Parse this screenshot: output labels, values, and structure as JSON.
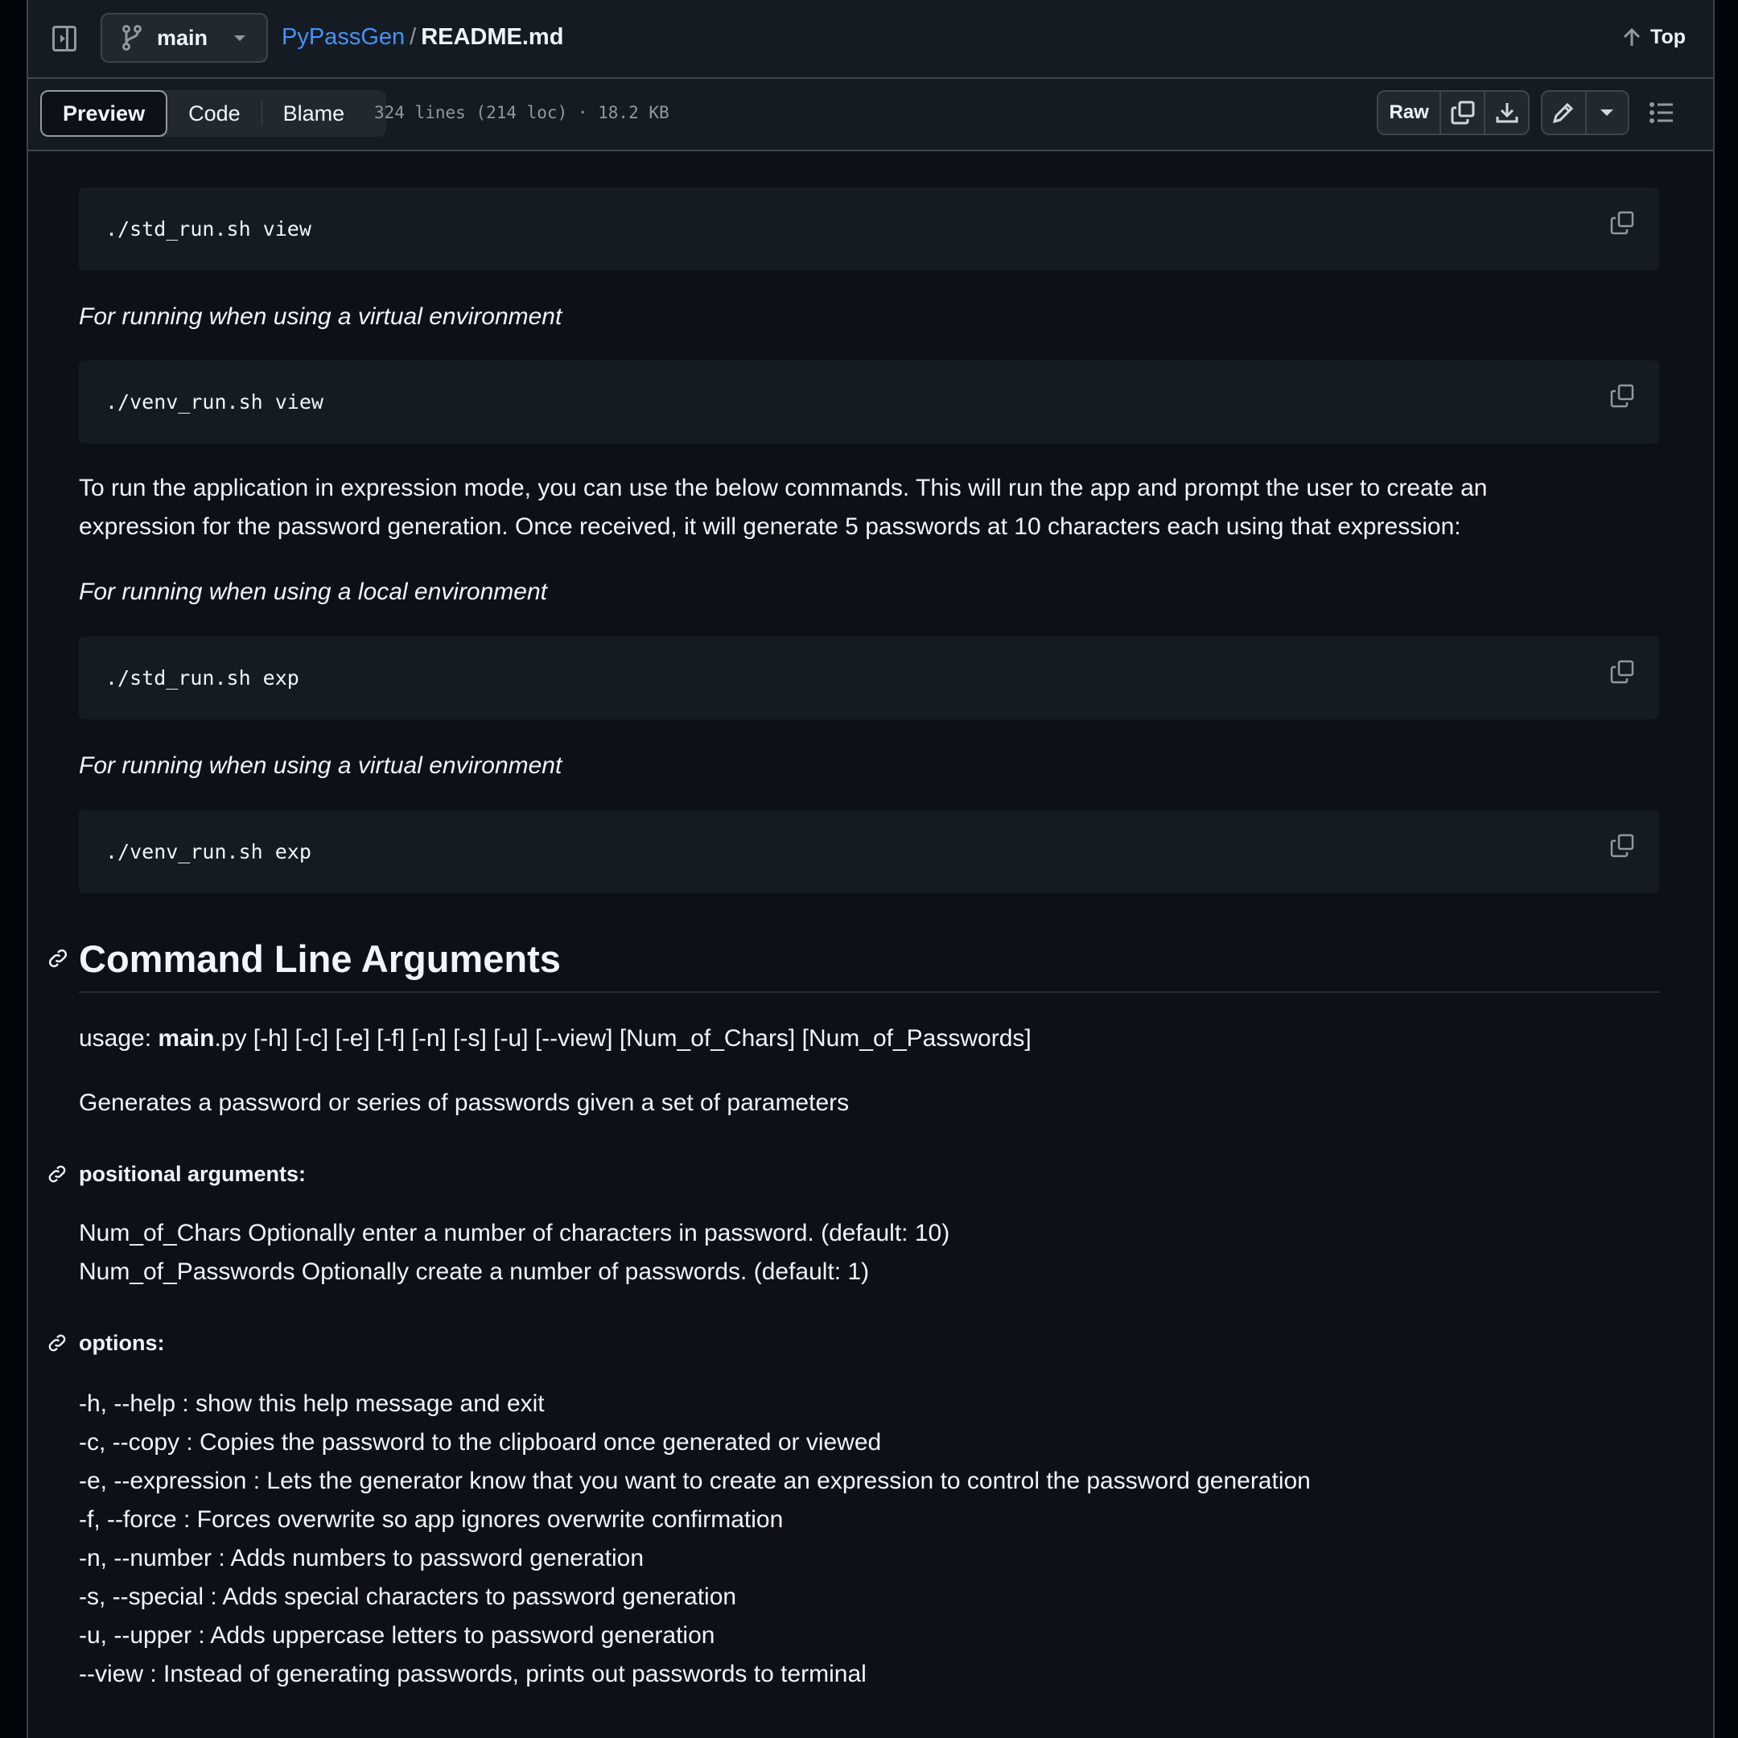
{
  "header": {
    "branch": "main",
    "repo": "PyPassGen",
    "separator": "/",
    "file": "README.md",
    "top_label": "Top"
  },
  "toolbar": {
    "tabs": [
      {
        "label": "Preview",
        "active": true
      },
      {
        "label": "Code"
      },
      {
        "label": "Blame"
      }
    ],
    "file_meta": "324 lines (214 loc) · 18.2 KB",
    "raw_label": "Raw"
  },
  "content": {
    "code1": "./std_run.sh view",
    "note1": "For running when using a virtual environment",
    "code2": "./venv_run.sh view",
    "para_line1": "To run the application in expression mode, you can use the below commands. This will run the app and prompt the user to create an",
    "para_line2": "expression for the password generation. Once received, it will generate 5 passwords at 10 characters each using that expression:",
    "note2": "For running when using a local environment",
    "code3": "./std_run.sh exp",
    "note3": "For running when using a virtual environment",
    "code4": "./venv_run.sh exp",
    "heading": "Command Line Arguments",
    "usage_prefix": "usage: ",
    "usage_bold": "main",
    "usage_rest": ".py [-h] [-c] [-e] [-f] [-n] [-s] [-u] [--view] [Num_of_Chars] [Num_of_Passwords]",
    "description": "Generates a password or series of passwords given a set of parameters",
    "positional_heading": "positional arguments:",
    "positional": [
      "Num_of_Chars Optionally enter a number of characters in password. (default: 10)",
      "Num_of_Passwords Optionally create a number of passwords. (default: 1)"
    ],
    "options_heading": "options:",
    "options": [
      "-h, --help : show this help message and exit",
      "-c, --copy : Copies the password to the clipboard once generated or viewed",
      "-e, --expression : Lets the generator know that you want to create an expression to control the password generation",
      "-f, --force : Forces overwrite so app ignores overwrite confirmation",
      "-n, --number : Adds numbers to password generation",
      "-s, --special : Adds special characters to password generation",
      "-u, --upper : Adds uppercase letters to password generation",
      "--view : Instead of generating passwords, prints out passwords to terminal"
    ]
  },
  "colors": {
    "background": "#0d1117",
    "header": "#151b23",
    "link": "#4493f8",
    "border": "#3d444d"
  }
}
